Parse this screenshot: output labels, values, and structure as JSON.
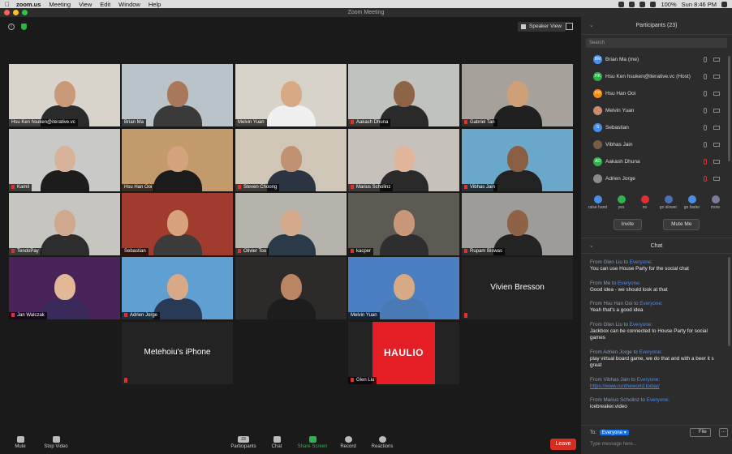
{
  "menubar": {
    "app": "zoom.us",
    "items": [
      "Meeting",
      "View",
      "Edit",
      "Window",
      "Help"
    ],
    "battery": "100%",
    "clock": "Sun 8:46 PM"
  },
  "window": {
    "title": "Zoom Meeting"
  },
  "view": {
    "speaker_view": "Speaker View"
  },
  "tiles": [
    {
      "name": "Hsu Ken hsuken@iterative.vc",
      "muted": false,
      "bg": "#d8d4cc",
      "skin": "#c99a77",
      "shirt": "#2a2a2a"
    },
    {
      "name": "Brian Ma",
      "muted": false,
      "bg": "#b9c3c9",
      "skin": "#a9785a",
      "shirt": "#3a3a3a"
    },
    {
      "name": "Melvin Yuan",
      "muted": false,
      "bg": "#d8d3c8",
      "skin": "#d8a985",
      "shirt": "#f0f0f0"
    },
    {
      "name": "Aakash Dhuna",
      "muted": true,
      "bg": "#bfc2bd",
      "skin": "#8e6446",
      "shirt": "#2a2a2a"
    },
    {
      "name": "Gabriel Tan",
      "muted": true,
      "bg": "#a6a29b",
      "skin": "#cfa078",
      "shirt": "#202020"
    },
    {
      "name": "Kamil",
      "muted": true,
      "bg": "#c9c9c7",
      "skin": "#d7b39a",
      "shirt": "#1c1c1c"
    },
    {
      "name": "Hsu Han Ooi",
      "muted": false,
      "bg": "#c39a6b",
      "skin": "#d4a47c",
      "shirt": "#1b1b1b",
      "active": true
    },
    {
      "name": "Steven Choong",
      "muted": true,
      "bg": "#cfc6b8",
      "skin": "#c19272",
      "shirt": "#2b3440"
    },
    {
      "name": "Marius Scholinz",
      "muted": true,
      "bg": "#c6c1bb",
      "skin": "#e0b59a",
      "shirt": "#2a2a2a"
    },
    {
      "name": "Vibhas Jain",
      "muted": true,
      "bg": "#6aa7c9",
      "skin": "#8a5e43",
      "shirt": "#222"
    },
    {
      "name": "TendoPay",
      "muted": true,
      "bg": "#c7c5c0",
      "skin": "#d0a88d",
      "shirt": "#2d2d2d"
    },
    {
      "name": "Sebastian",
      "muted": false,
      "bg": "#a03b2e",
      "skin": "#d7a27c",
      "shirt": "#3b3b3b"
    },
    {
      "name": "Olivier Too",
      "muted": true,
      "bg": "#b5b3ac",
      "skin": "#d4aa8a",
      "shirt": "#2a3a48"
    },
    {
      "name": "kacper",
      "muted": true,
      "bg": "#5c5a52",
      "skin": "#c99879",
      "shirt": "#2e2e2e"
    },
    {
      "name": "Rupam Biswas",
      "muted": true,
      "bg": "#9e9c98",
      "skin": "#8d6246",
      "shirt": "#232323"
    },
    {
      "name": "Jan Walczak",
      "muted": true,
      "bg": "#4a2458",
      "skin": "#e3b897",
      "shirt": "#3a2a5a"
    },
    {
      "name": "Adrien Jorge",
      "muted": true,
      "bg": "#5f9fd2",
      "skin": "#d8a987",
      "shirt": "#283a55"
    },
    {
      "name": "",
      "muted": false,
      "bg": "#2c2b2a",
      "skin": "#b98563",
      "shirt": "#1d1d1d"
    },
    {
      "name": "Melvin Yuan",
      "muted": false,
      "bg": "#4b7fc1",
      "skin": "#d8a985",
      "shirt": "#4a7ab5"
    },
    {
      "name": "Vivien Bresson",
      "muted": true,
      "text_only": true
    },
    {
      "name": "",
      "empty": true
    },
    {
      "name": "Metehoiu's iPhone",
      "muted": true,
      "text_only": true
    },
    {
      "name": "",
      "empty": true
    },
    {
      "name": "Glen Liu",
      "muted": true,
      "haulio": "HAULIO"
    },
    {
      "name": "",
      "empty": true
    }
  ],
  "toolbar": {
    "mute": "Mute",
    "stop_video": "Stop Video",
    "participants": "Participants",
    "participants_count": "23",
    "chat": "Chat",
    "share_screen": "Share Screen",
    "record": "Record",
    "reactions": "Reactions",
    "leave": "Leave"
  },
  "participants_panel": {
    "title": "Participants (23)",
    "search_placeholder": "Search",
    "list": [
      {
        "initials": "BM",
        "name": "Brian Ma (me)",
        "color": "#4a8fe7",
        "mic_muted": false
      },
      {
        "initials": "HK",
        "name": "Hsu Ken hsuken@iterative.vc (Host)",
        "color": "#2db34a",
        "mic_muted": false
      },
      {
        "initials": "HH",
        "name": "Hsu Han Ooi",
        "color": "#f08c1a",
        "mic_muted": false
      },
      {
        "initials": "",
        "name": "Melvin Yuan",
        "color": "#c98b6a",
        "mic_muted": false
      },
      {
        "initials": "S",
        "name": "Sebastian",
        "color": "#4a8fe7",
        "mic_muted": false
      },
      {
        "initials": "",
        "name": "Vibhas Jain",
        "color": "#7a5a44",
        "mic_muted": false
      },
      {
        "initials": "AD",
        "name": "Aakash Dhuna",
        "color": "#2db34a",
        "mic_muted": true
      },
      {
        "initials": "",
        "name": "Adrien Jorge",
        "color": "#8a8a8a",
        "mic_muted": true
      }
    ],
    "reactions": [
      {
        "label": "raise hand",
        "color": "#4a8fe7"
      },
      {
        "label": "yes",
        "color": "#2db34a"
      },
      {
        "label": "no",
        "color": "#e03131"
      },
      {
        "label": "go slower",
        "color": "#4a6fb7"
      },
      {
        "label": "go faster",
        "color": "#4a8fe7"
      },
      {
        "label": "more",
        "color": "#7a7a9a"
      }
    ],
    "invite": "Invite",
    "mute_me": "Mute Me"
  },
  "chat_panel": {
    "title": "Chat",
    "messages": [
      {
        "from": "Glen Liu",
        "to": "Everyone",
        "text": "You can use House Party for the social chat"
      },
      {
        "from": "Me",
        "to": "Everyone",
        "text": "Good idea - we should look at that"
      },
      {
        "from": "Hsu Han Ooi",
        "to": "Everyone",
        "text": "Yeah that's a good idea"
      },
      {
        "from": "Glen Liu",
        "to": "Everyone",
        "text": "Jackbox can be connected to House Party for social games"
      },
      {
        "from": "Adrien Jorge",
        "to": "Everyone",
        "text": "play virtual board game, we do that and with a beer it s great"
      },
      {
        "from": "Vibhas Jain",
        "to": "Everyone",
        "text": "https://www.runtheworld.today/",
        "link": true
      },
      {
        "from": "Marius Scholinz",
        "to": "Everyone",
        "text": "icebreaker.video"
      }
    ],
    "to_label": "To:",
    "to_value": "Everyone",
    "file": "File",
    "more": "...",
    "input_placeholder": "Type message here..."
  }
}
